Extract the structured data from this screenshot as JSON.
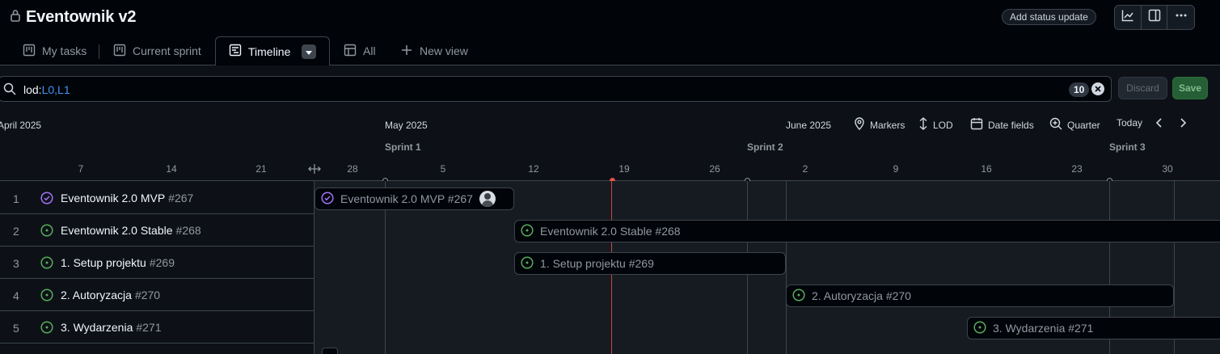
{
  "header": {
    "title": "Eventownik v2",
    "status_update_label": "Add status update"
  },
  "tabs": [
    {
      "label": "My tasks",
      "icon": "board-icon"
    },
    {
      "label": "Current sprint",
      "icon": "board-icon"
    },
    {
      "label": "Timeline",
      "icon": "timeline-icon",
      "active": true
    },
    {
      "label": "All",
      "icon": "table-icon"
    },
    {
      "label": "New view",
      "icon": "plus-icon"
    }
  ],
  "filter": {
    "key": "lod:",
    "values": "L0,L1",
    "count": "10",
    "discard_label": "Discard",
    "save_label": "Save"
  },
  "timeline": {
    "months": [
      "April 2025",
      "May 2025",
      "June 2025"
    ],
    "sprints": [
      "Sprint 1",
      "Sprint 2",
      "Sprint 3"
    ],
    "days": [
      "7",
      "14",
      "21",
      "28",
      "5",
      "12",
      "19",
      "26",
      "2",
      "9",
      "16",
      "23",
      "30"
    ],
    "controls": {
      "markers": "Markers",
      "lod": "LOD",
      "date_fields": "Date fields",
      "zoom": "Quarter",
      "today": "Today"
    }
  },
  "items": [
    {
      "num": "1",
      "name": "Eventownik 2.0 MVP",
      "id": "#267",
      "status": "done",
      "bar_label": "Eventownik 2.0 MVP #267"
    },
    {
      "num": "2",
      "name": "Eventownik 2.0 Stable",
      "id": "#268",
      "status": "open",
      "bar_label": "Eventownik 2.0 Stable #268"
    },
    {
      "num": "3",
      "name": "1. Setup projektu",
      "id": "#269",
      "status": "open",
      "bar_label": "1. Setup projektu #269"
    },
    {
      "num": "4",
      "name": "2. Autoryzacja",
      "id": "#270",
      "status": "open",
      "bar_label": "2. Autoryzacja #270"
    },
    {
      "num": "5",
      "name": "3. Wydarzenia",
      "id": "#271",
      "status": "open",
      "bar_label": "3. Wydarzenia #271"
    }
  ],
  "colors": {
    "done": "#a371f7",
    "open": "#57ab5a",
    "today_line": "#c9463d",
    "save_bg": "#29683a"
  }
}
